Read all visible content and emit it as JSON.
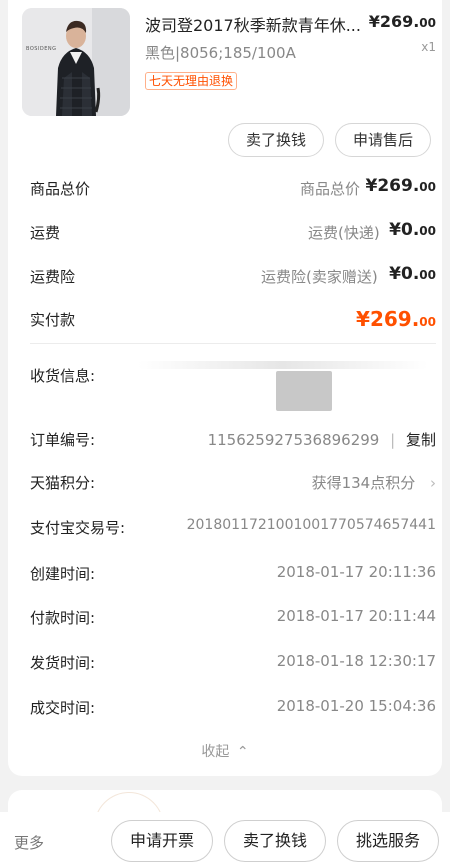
{
  "product": {
    "brand_mark": "BOSIDENG",
    "title": "波司登2017秋季新款青年休...",
    "price_main": "¥269.",
    "price_cents": "00",
    "qty": "x1",
    "spec": "黑色|8056;185/100A",
    "tag": "七天无理由退换",
    "btn_resell": "卖了换钱",
    "btn_aftersale": "申请售后"
  },
  "summary": {
    "goods_total_label": "商品总价",
    "goods_total_sub": "商品总价",
    "goods_total_main": "¥269.",
    "goods_total_cents": "00",
    "shipping_label": "运费",
    "shipping_sub": "运费(快递)",
    "shipping_main": "¥0.",
    "shipping_cents": "00",
    "insurance_label": "运费险",
    "insurance_sub": "运费险(卖家赠送)",
    "insurance_main": "¥0.",
    "insurance_cents": "00",
    "paid_label": "实付款",
    "paid_main": "¥269.",
    "paid_cents": "00"
  },
  "order": {
    "shipping_info_label": "收货信息:",
    "order_no_label": "订单编号:",
    "order_no": "115625927536896299",
    "copy_sep": "|",
    "copy_label": "复制",
    "tmall_points_label": "天猫积分:",
    "tmall_points_value": "获得134点积分",
    "alipay_label": "支付宝交易号:",
    "alipay_value": "2018011721001001770574657441",
    "created_label": "创建时间:",
    "created_value": "2018-01-17 20:11:36",
    "paid_time_label": "付款时间:",
    "paid_time_value": "2018-01-17 20:11:44",
    "shipped_label": "发货时间:",
    "shipped_value": "2018-01-18 12:30:17",
    "completed_label": "成交时间:",
    "completed_value": "2018-01-20 15:04:36",
    "collapse_label": "收起"
  },
  "bottombar": {
    "more": "更多",
    "invoice": "申请开票",
    "resell": "卖了换钱",
    "services": "挑选服务"
  },
  "colors": {
    "accent": "#ff5000",
    "background": "#f2f2f2"
  }
}
